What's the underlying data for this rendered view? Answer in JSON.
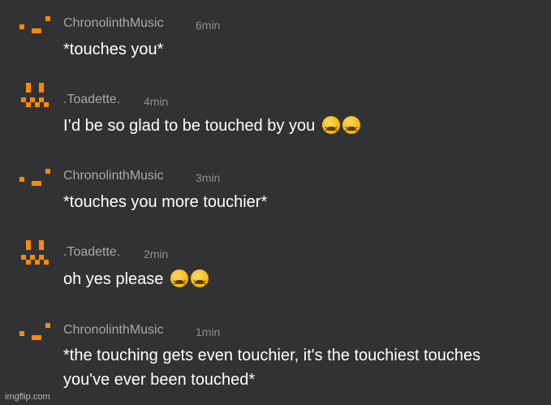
{
  "messages": [
    {
      "author": "ChronolinthMusic",
      "time": "6min",
      "text": "*touches you*",
      "emoji_count": 0
    },
    {
      "author": ".Toadette.",
      "time": "4min",
      "text": "I’d be so glad to be touched by you",
      "emoji_count": 2
    },
    {
      "author": "ChronolinthMusic",
      "time": "3min",
      "text": "*touches you more touchier*",
      "emoji_count": 0
    },
    {
      "author": ".Toadette.",
      "time": "2min",
      "text": "oh yes please",
      "emoji_count": 2
    },
    {
      "author": "ChronolinthMusic",
      "time": "1min",
      "text": "*the touching gets even touchier, it's the touchiest touches you've ever been touched*",
      "emoji_count": 0
    }
  ],
  "emoji_icon": "tired-face-icon",
  "avatar_color": "#ff8a00",
  "watermark": "imgflip.com"
}
